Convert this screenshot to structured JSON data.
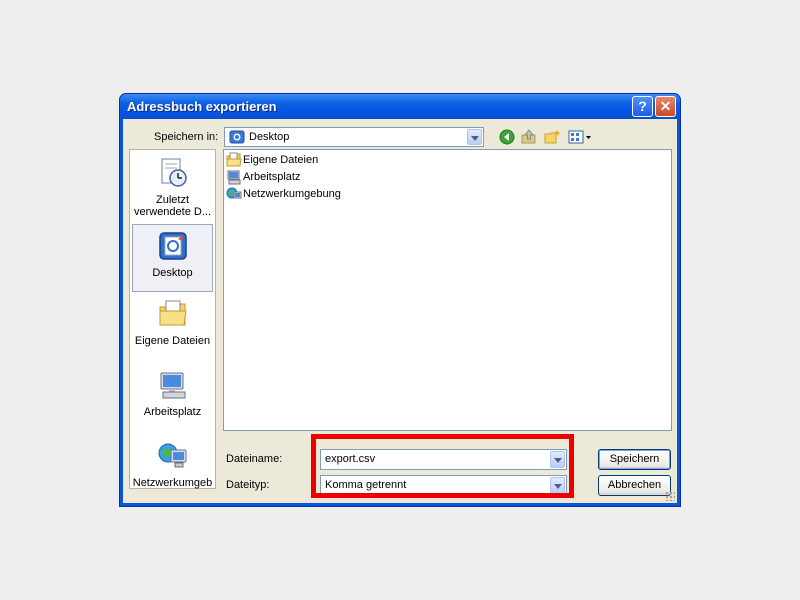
{
  "window": {
    "title": "Adressbuch exportieren",
    "help_label": "?",
    "close_label": "✕"
  },
  "toolbar": {
    "save_in_label": "Speichern in:",
    "location_value": "Desktop",
    "icons": [
      "back-icon",
      "up-folder-icon",
      "new-folder-icon",
      "views-menu-icon"
    ]
  },
  "places": [
    {
      "label": "Zuletzt verwendete D...",
      "icon": "recent-documents-icon"
    },
    {
      "label": "Desktop",
      "icon": "desktop-icon",
      "selected": true
    },
    {
      "label": "Eigene Dateien",
      "icon": "my-documents-icon"
    },
    {
      "label": "Arbeitsplatz",
      "icon": "my-computer-icon"
    },
    {
      "label": "Netzwerkumgeb",
      "icon": "network-places-icon"
    }
  ],
  "files": [
    {
      "name": "Eigene Dateien",
      "icon": "my-documents-icon"
    },
    {
      "name": "Arbeitsplatz",
      "icon": "my-computer-icon"
    },
    {
      "name": "Netzwerkumgebung",
      "icon": "network-places-icon"
    }
  ],
  "form": {
    "filename_label": "Dateiname:",
    "filename_value": "export.csv",
    "filetype_label": "Dateityp:",
    "filetype_value": "Komma getrennt"
  },
  "buttons": {
    "save": "Speichern",
    "cancel": "Abbrechen"
  },
  "colors": {
    "titlebar": "#0855dd",
    "dialog_bg": "#ece9d8",
    "highlight": "#ee0000"
  }
}
